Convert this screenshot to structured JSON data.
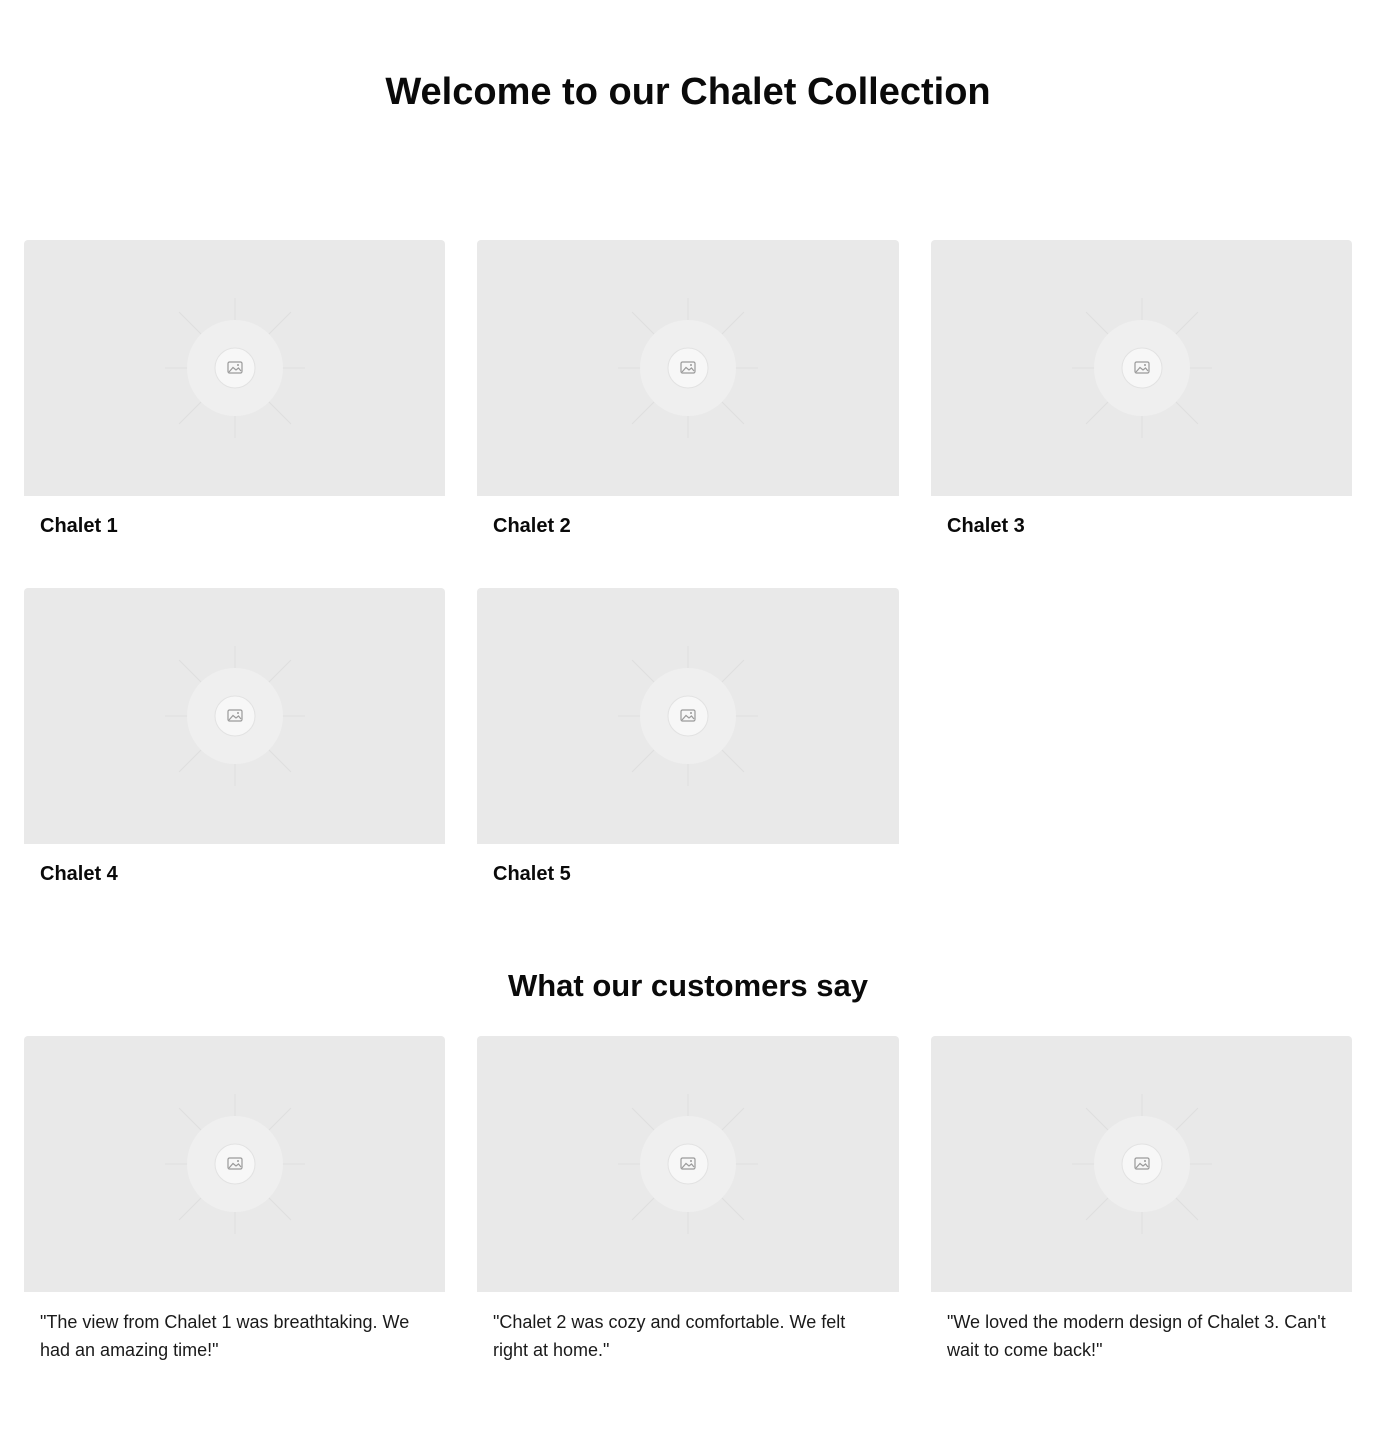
{
  "page": {
    "title": "Welcome to our Chalet Collection"
  },
  "chalets": [
    {
      "name": "Chalet 1",
      "image_icon": "image-placeholder-icon"
    },
    {
      "name": "Chalet 2",
      "image_icon": "image-placeholder-icon"
    },
    {
      "name": "Chalet 3",
      "image_icon": "image-placeholder-icon"
    },
    {
      "name": "Chalet 4",
      "image_icon": "image-placeholder-icon"
    },
    {
      "name": "Chalet 5",
      "image_icon": "image-placeholder-icon"
    }
  ],
  "testimonials": {
    "title": "What our customers say",
    "items": [
      {
        "quote": "\"The view from Chalet 1 was breathtaking. We had an amazing time!\"",
        "image_icon": "image-placeholder-icon"
      },
      {
        "quote": "\"Chalet 2 was cozy and comfortable. We felt right at home.\"",
        "image_icon": "image-placeholder-icon"
      },
      {
        "quote": "\"We loved the modern design of Chalet 3. Can't wait to come back!\"",
        "image_icon": "image-placeholder-icon"
      }
    ]
  },
  "colors": {
    "background": "#ffffff",
    "placeholder": "#e9e9e9",
    "text": "#0a0a0a"
  }
}
